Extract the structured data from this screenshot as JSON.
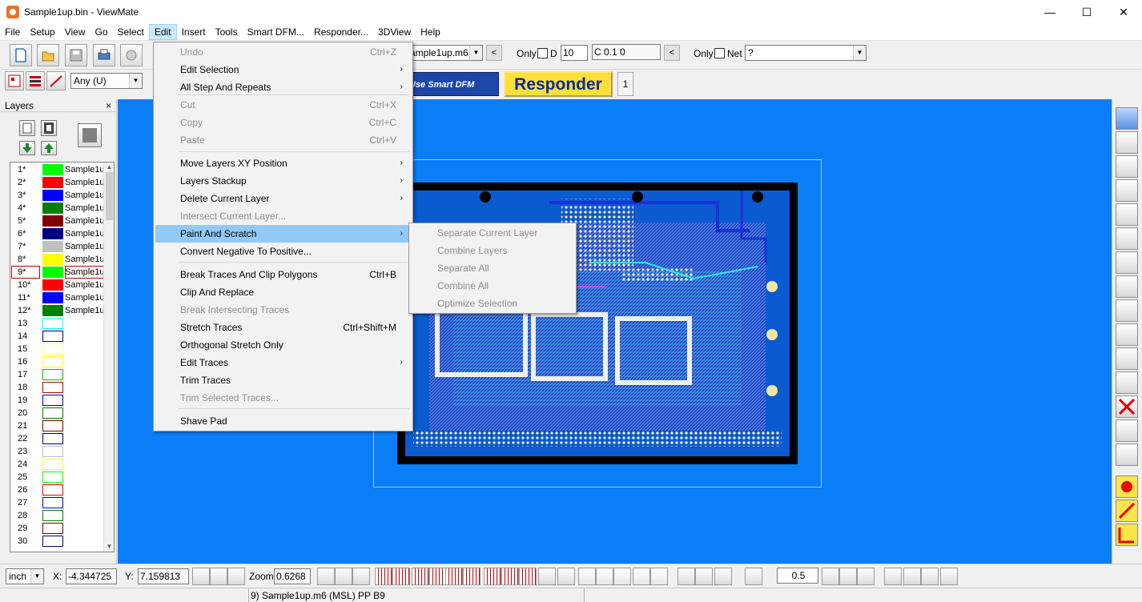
{
  "window": {
    "title": "Sample1up.bin - ViewMate",
    "minimize": "—",
    "maximize": "☐",
    "close": "✕"
  },
  "menubar": [
    "File",
    "Setup",
    "View",
    "Go",
    "Select",
    "Edit",
    "Insert",
    "Tools",
    "Smart DFM...",
    "Responder...",
    "3DView",
    "Help"
  ],
  "toolbar": {
    "layer_select": "ample1up.m6",
    "prev": "<",
    "only_label": "Only",
    "d_label": "D",
    "d_value": "10",
    "c_field": "C 0.1  0",
    "prev2": "<",
    "only2_label": "Only",
    "net_label": "Net",
    "net_value": "?",
    "filter_value": "Any   (U)",
    "smart_dfm": "Use Smart DFM",
    "responder": "Responder",
    "responder_num": "1"
  },
  "layers_panel": {
    "title": "Layers",
    "close": "×",
    "rows": [
      {
        "num": "1*",
        "color": "#00ff00",
        "name": "Sample1u",
        "filled": true
      },
      {
        "num": "2*",
        "color": "#ff0000",
        "name": "Sample1u",
        "filled": true
      },
      {
        "num": "3*",
        "color": "#0000ff",
        "name": "Sample1u",
        "filled": true
      },
      {
        "num": "4*",
        "color": "#008000",
        "name": "Sample1u",
        "filled": true
      },
      {
        "num": "5*",
        "color": "#800000",
        "name": "Sample1u",
        "filled": true
      },
      {
        "num": "6*",
        "color": "#000080",
        "name": "Sample1u",
        "filled": true
      },
      {
        "num": "7*",
        "color": "#c0c0c0",
        "name": "Sample1u",
        "filled": true
      },
      {
        "num": "8*",
        "color": "#ffff00",
        "name": "Sample1u",
        "filled": true
      },
      {
        "num": "9*",
        "color": "#00ff00",
        "name": "Sample1u",
        "filled": true,
        "selected": true
      },
      {
        "num": "10*",
        "color": "#ff0000",
        "name": "Sample1u",
        "filled": true
      },
      {
        "num": "11*",
        "color": "#0000ff",
        "name": "Sample1u",
        "filled": true
      },
      {
        "num": "12*",
        "color": "#008000",
        "name": "Sample1u",
        "filled": true
      },
      {
        "num": "13",
        "color": "#00ffff",
        "name": "",
        "filled": false
      },
      {
        "num": "14",
        "color": "#000080",
        "name": "",
        "filled": false
      },
      {
        "num": "15",
        "color": "#ffff80",
        "name": "",
        "filled": false
      },
      {
        "num": "16",
        "color": "#ffff00",
        "name": "",
        "filled": false
      },
      {
        "num": "17",
        "color": "#00c000",
        "name": "",
        "filled": false
      },
      {
        "num": "18",
        "color": "#c00000",
        "name": "",
        "filled": false
      },
      {
        "num": "19",
        "color": "#0000c0",
        "name": "",
        "filled": false
      },
      {
        "num": "20",
        "color": "#008000",
        "name": "",
        "filled": false
      },
      {
        "num": "21",
        "color": "#800000",
        "name": "",
        "filled": false
      },
      {
        "num": "22",
        "color": "#000080",
        "name": "",
        "filled": false
      },
      {
        "num": "23",
        "color": "#c0c0c0",
        "name": "",
        "filled": false
      },
      {
        "num": "24",
        "color": "#ffff00",
        "name": "",
        "filled": false
      },
      {
        "num": "25",
        "color": "#00ff00",
        "name": "",
        "filled": false
      },
      {
        "num": "26",
        "color": "#ff0000",
        "name": "",
        "filled": false
      },
      {
        "num": "27",
        "color": "#0000ff",
        "name": "",
        "filled": false
      },
      {
        "num": "28",
        "color": "#008000",
        "name": "",
        "filled": false
      },
      {
        "num": "29",
        "color": "#800000",
        "name": "",
        "filled": false
      },
      {
        "num": "30",
        "color": "#000080",
        "name": "",
        "filled": false
      }
    ]
  },
  "edit_menu": {
    "items": [
      {
        "label": "Undo",
        "shortcut": "Ctrl+Z",
        "disabled": true
      },
      {
        "label": "Edit Selection",
        "submenu": true
      },
      {
        "label": "All Step And Repeats",
        "submenu": true
      },
      {
        "label": "Cut",
        "shortcut": "Ctrl+X",
        "disabled": true
      },
      {
        "label": "Copy",
        "shortcut": "Ctrl+C",
        "disabled": true
      },
      {
        "label": "Paste",
        "shortcut": "Ctrl+V",
        "disabled": true
      },
      {
        "label": "Move Layers XY Position",
        "submenu": true
      },
      {
        "label": "Layers Stackup",
        "submenu": true
      },
      {
        "label": "Delete Current Layer",
        "submenu": true
      },
      {
        "label": "Intersect Current Layer...",
        "disabled": true
      },
      {
        "label": "Paint And Scratch",
        "submenu": true,
        "highlight": true
      },
      {
        "label": "Convert Negative To Positive..."
      },
      {
        "label": "Break Traces And Clip Polygons",
        "shortcut": "Ctrl+B"
      },
      {
        "label": "Clip And Replace"
      },
      {
        "label": "Break Intersecting Traces",
        "disabled": true
      },
      {
        "label": "Stretch Traces",
        "shortcut": "Ctrl+Shift+M"
      },
      {
        "label": "Orthogonal Stretch Only"
      },
      {
        "label": "Edit Traces",
        "submenu": true
      },
      {
        "label": "Trim Traces"
      },
      {
        "label": "Trim Selected Traces...",
        "disabled": true
      },
      {
        "label": "Shave Pad"
      }
    ],
    "submenu_arrow": "›"
  },
  "paint_submenu": [
    "Separate Current Layer",
    "Combine Layers",
    "Separate All",
    "Combine All",
    "Optimize Selection"
  ],
  "bottom": {
    "units": "inch",
    "x_label": "X:",
    "x_value": "-4.344725",
    "y_label": "Y:",
    "y_value": "7.159813",
    "zoom_label": "Zoom:",
    "zoom_value": "0.6268",
    "grid_value": "0.5"
  },
  "status": {
    "text": "9) Sample1up.m6 (MSL) PP B9"
  }
}
